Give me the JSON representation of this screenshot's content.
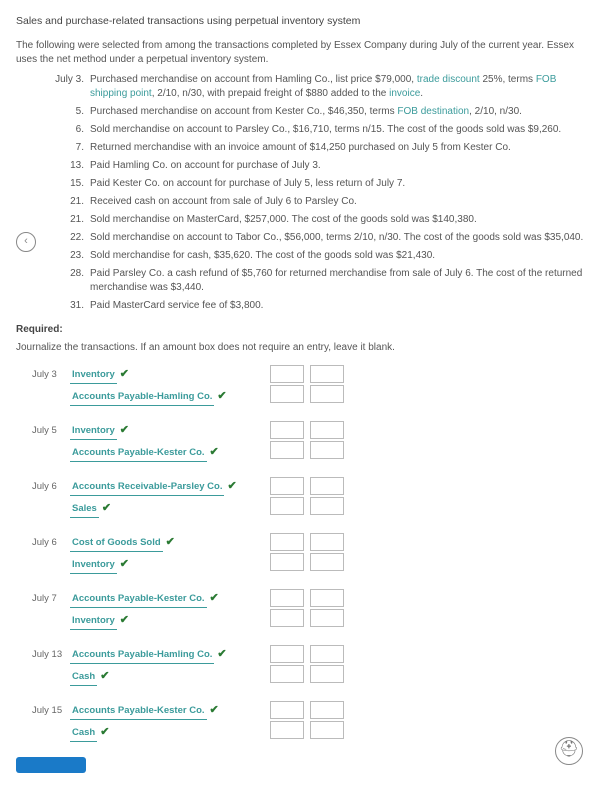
{
  "title": "Sales and purchase-related transactions using perpetual inventory system",
  "intro": "The following were selected from among the transactions completed by Essex Company during July of the current year. Essex uses the net method under a perpetual inventory system.",
  "transactions": [
    {
      "date": "July 3.",
      "pre": "Purchased merchandise on account from Hamling Co., list price $79,000, ",
      "t1": "trade discount",
      "mid1": " 25%, terms ",
      "t2": "FOB shipping point",
      "mid2": ", 2/10, n/30, with prepaid freight of $880 added to the ",
      "t3": "invoice",
      "post": "."
    },
    {
      "date": "5.",
      "pre": "Purchased merchandise on account from Kester Co., $46,350, terms ",
      "t1": "FOB destination",
      "mid1": ", 2/10, n/30.",
      "t2": "",
      "mid2": "",
      "t3": "",
      "post": ""
    },
    {
      "date": "6.",
      "pre": "Sold merchandise on account to Parsley Co., $16,710, terms n/15. The cost of the goods sold was $9,260.",
      "t1": "",
      "mid1": "",
      "t2": "",
      "mid2": "",
      "t3": "",
      "post": ""
    },
    {
      "date": "7.",
      "pre": "Returned merchandise with an invoice amount of $14,250 purchased on July 5 from Kester Co.",
      "t1": "",
      "mid1": "",
      "t2": "",
      "mid2": "",
      "t3": "",
      "post": ""
    },
    {
      "date": "13.",
      "pre": "Paid Hamling Co. on account for purchase of July 3.",
      "t1": "",
      "mid1": "",
      "t2": "",
      "mid2": "",
      "t3": "",
      "post": ""
    },
    {
      "date": "15.",
      "pre": "Paid Kester Co. on account for purchase of July 5, less return of July 7.",
      "t1": "",
      "mid1": "",
      "t2": "",
      "mid2": "",
      "t3": "",
      "post": ""
    },
    {
      "date": "21.",
      "pre": "Received cash on account from sale of July 6 to Parsley Co.",
      "t1": "",
      "mid1": "",
      "t2": "",
      "mid2": "",
      "t3": "",
      "post": ""
    },
    {
      "date": "21.",
      "pre": "Sold merchandise on MasterCard, $257,000. The cost of the goods sold was $140,380.",
      "t1": "",
      "mid1": "",
      "t2": "",
      "mid2": "",
      "t3": "",
      "post": ""
    },
    {
      "date": "22.",
      "pre": "Sold merchandise on account to Tabor Co., $56,000, terms 2/10, n/30. The cost of the goods sold was $35,040.",
      "t1": "",
      "mid1": "",
      "t2": "",
      "mid2": "",
      "t3": "",
      "post": ""
    },
    {
      "date": "23.",
      "pre": "Sold merchandise for cash, $35,620. The cost of the goods sold was $21,430.",
      "t1": "",
      "mid1": "",
      "t2": "",
      "mid2": "",
      "t3": "",
      "post": ""
    },
    {
      "date": "28.",
      "pre": "Paid Parsley Co. a cash refund of $5,760 for returned merchandise from sale of July 6. The cost of the returned merchandise was $3,440.",
      "t1": "",
      "mid1": "",
      "t2": "",
      "mid2": "",
      "t3": "",
      "post": ""
    },
    {
      "date": "31.",
      "pre": "Paid MasterCard service fee of $3,800.",
      "t1": "",
      "mid1": "",
      "t2": "",
      "mid2": "",
      "t3": "",
      "post": ""
    }
  ],
  "required_label": "Required:",
  "required_instr": "Journalize the transactions. If an amount box does not require an entry, leave it blank.",
  "journal": [
    {
      "date": "July 3",
      "lines": [
        "Inventory",
        "Accounts Payable-Hamling Co."
      ]
    },
    {
      "date": "July 5",
      "lines": [
        "Inventory",
        "Accounts Payable-Kester Co."
      ]
    },
    {
      "date": "July 6",
      "lines": [
        "Accounts Receivable-Parsley Co.",
        "Sales"
      ]
    },
    {
      "date": "July 6",
      "lines": [
        "Cost of Goods Sold",
        "Inventory"
      ]
    },
    {
      "date": "July 7",
      "lines": [
        "Accounts Payable-Kester Co.",
        "Inventory"
      ]
    },
    {
      "date": "July 13",
      "lines": [
        "Accounts Payable-Hamling Co.",
        "Cash"
      ]
    },
    {
      "date": "July 15",
      "lines": [
        "Accounts Payable-Kester Co.",
        "Cash"
      ]
    }
  ],
  "nav_prev": "‹",
  "help_icon": "⛑"
}
